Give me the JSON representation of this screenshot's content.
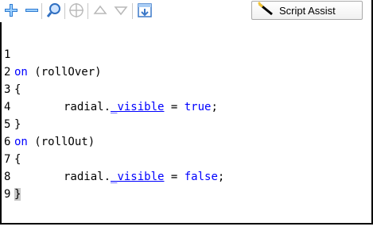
{
  "toolbar": {
    "script_assist_label": "Script Assist"
  },
  "code_lines": [
    {
      "number": "1",
      "kw": "on",
      "rest": " (rollOver)"
    },
    {
      "number": "2",
      "text": "{"
    },
    {
      "number": "3",
      "obj": "radial.",
      "prop": "_visible",
      "op": " = ",
      "val": "true",
      "end": ";"
    },
    {
      "number": "4",
      "text": "}"
    },
    {
      "number": "5",
      "kw": "on",
      "rest": " (rollOut)"
    },
    {
      "number": "6",
      "text": "{"
    },
    {
      "number": "7",
      "obj": "radial.",
      "prop": "_visible",
      "op": " = ",
      "val": "false",
      "end": ";"
    },
    {
      "number": "8",
      "text": "}"
    },
    {
      "number": "9",
      "text": ""
    }
  ]
}
